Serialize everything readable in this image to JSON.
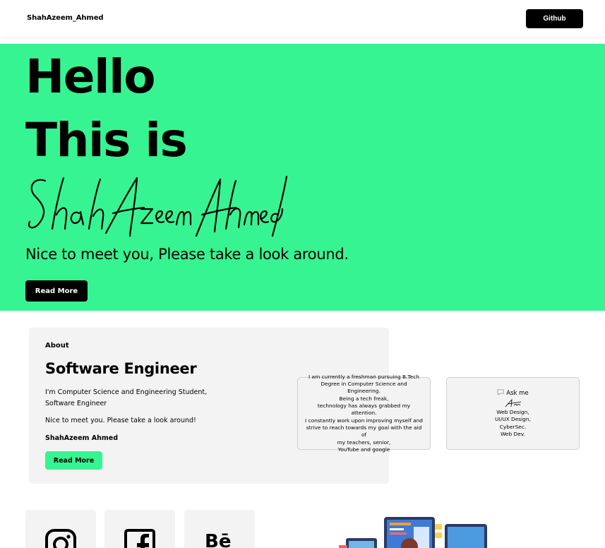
{
  "header": {
    "brand": "ShahAzeem_Ahmed",
    "github_label": "Github"
  },
  "hero": {
    "line1": "Hello",
    "line2": "This is",
    "signature_text": "ShahAzeem Ahmed",
    "tagline": "Nice to meet you, Please take a  look around.",
    "read_more": "Read More"
  },
  "about": {
    "label": "About",
    "title": "Software Engineer",
    "desc_line1": "I'm Computer Science and Engineering Student,",
    "desc_line2": "Software Engineer",
    "meet": "Nice to meet you. Please take a look around!",
    "name": "ShahAzeem Ahmed",
    "read_more": "Read More"
  },
  "bio_card": {
    "lines": [
      "I am currently a freshman pursuing B.Tech",
      "Degree in Computer Science and Engineering.",
      "Being a tech freak,",
      "technology has always grabbed my attention.",
      "I constantly work upon improving myself and",
      "strive to reach towards my goal with the aid of",
      "my teachers, senior,",
      "YouTube and google"
    ]
  },
  "ask_card": {
    "title": "Ask me",
    "signature_text": "About",
    "skills": [
      "Web Design,",
      "UI/UX Design,",
      "CyberSec.",
      "Web Dev."
    ]
  },
  "socials": {
    "icons": [
      "instagram-icon",
      "facebook-icon",
      "behance-icon"
    ],
    "behance_text": "Bē"
  },
  "colors": {
    "accent": "#36f491",
    "card": "#f3f3f3",
    "dark": "#000000"
  }
}
